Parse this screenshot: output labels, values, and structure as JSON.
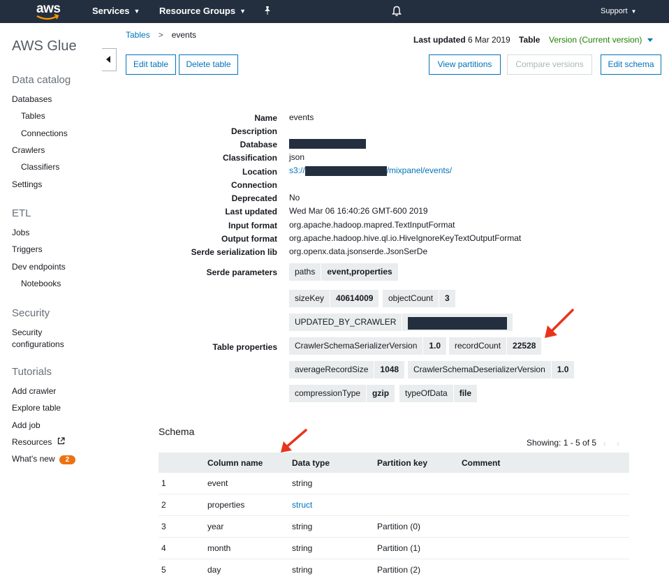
{
  "topnav": {
    "logo_text": "aws",
    "services": "Services",
    "resource_groups": "Resource Groups",
    "support": "Support"
  },
  "sidebar": {
    "title": "AWS Glue",
    "data_catalog": "Data catalog",
    "databases": "Databases",
    "tables": "Tables",
    "connections": "Connections",
    "crawlers": "Crawlers",
    "classifiers": "Classifiers",
    "settings": "Settings",
    "etl": "ETL",
    "jobs": "Jobs",
    "triggers": "Triggers",
    "dev_endpoints": "Dev endpoints",
    "notebooks": "Notebooks",
    "security": "Security",
    "security_configurations_1": "Security",
    "security_configurations_2": "configurations",
    "tutorials": "Tutorials",
    "add_crawler": "Add crawler",
    "explore_table": "Explore table",
    "add_job": "Add job",
    "resources": "Resources",
    "whats_new": "What's new",
    "whats_new_badge": "2"
  },
  "header": {
    "breadcrumb_tables": "Tables",
    "breadcrumb_sep": ">",
    "breadcrumb_current": "events",
    "last_updated_label": "Last updated",
    "last_updated_value": "6 Mar 2019",
    "table_label": "Table",
    "version": "Version (Current version)"
  },
  "buttons": {
    "edit_table": "Edit table",
    "delete_table": "Delete table",
    "view_partitions": "View partitions",
    "compare_versions": "Compare versions",
    "edit_schema": "Edit schema"
  },
  "details": {
    "name_label": "Name",
    "name": "events",
    "description_label": "Description",
    "database_label": "Database",
    "classification_label": "Classification",
    "classification": "json",
    "location_label": "Location",
    "location_prefix": "s3://",
    "location_suffix": "/mixpanel/events/",
    "connection_label": "Connection",
    "deprecated_label": "Deprecated",
    "deprecated": "No",
    "last_updated_label": "Last updated",
    "last_updated": "Wed Mar 06 16:40:26 GMT-600 2019",
    "input_format_label": "Input format",
    "input_format": "org.apache.hadoop.mapred.TextInputFormat",
    "output_format_label": "Output format",
    "output_format": "org.apache.hadoop.hive.ql.io.HiveIgnoreKeyTextOutputFormat",
    "serde_lib_label": "Serde serialization lib",
    "serde_lib": "org.openx.data.jsonserde.JsonSerDe",
    "serde_params_label": "Serde parameters",
    "table_props_label": "Table properties"
  },
  "serde_params": [
    {
      "k": "paths",
      "v": "event,properties"
    }
  ],
  "table_props": {
    "sizeKey": "sizeKey",
    "sizeKey_v": "40614009",
    "objectCount": "objectCount",
    "objectCount_v": "3",
    "updated": "UPDATED_BY_CRAWLER",
    "css": "CrawlerSchemaSerializerVersion",
    "css_v": "1.0",
    "recordCount": "recordCount",
    "recordCount_v": "22528",
    "avg": "averageRecordSize",
    "avg_v": "1048",
    "csd": "CrawlerSchemaDeserializerVersion",
    "csd_v": "1.0",
    "comp": "compressionType",
    "comp_v": "gzip",
    "tod": "typeOfData",
    "tod_v": "file"
  },
  "schema": {
    "title": "Schema",
    "showing": "Showing: 1 - 5 of 5",
    "headers": [
      "Column name",
      "Data type",
      "Partition key",
      "Comment"
    ],
    "rows": [
      {
        "n": "1",
        "col": "event",
        "type": "string",
        "pk": ""
      },
      {
        "n": "2",
        "col": "properties",
        "type": "struct",
        "pk": ""
      },
      {
        "n": "3",
        "col": "year",
        "type": "string",
        "pk": "Partition (0)"
      },
      {
        "n": "4",
        "col": "month",
        "type": "string",
        "pk": "Partition (1)"
      },
      {
        "n": "5",
        "col": "day",
        "type": "string",
        "pk": "Partition (2)"
      }
    ]
  },
  "colors": {
    "nav_bg": "#232f3e",
    "link": "#0073bb",
    "version_green": "#1d8102",
    "badge_orange": "#ec7211",
    "annotation_red": "#e8341c"
  }
}
